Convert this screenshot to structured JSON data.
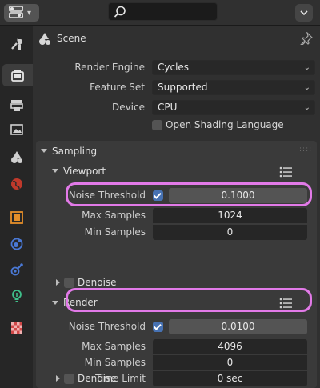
{
  "topbar": {
    "editor_type_icon": "properties-editor-icon",
    "search_icon": "search-icon",
    "menu_icon": "chevron-down-icon"
  },
  "tabs": [
    {
      "name": "tool",
      "icon": "tool-icon"
    },
    {
      "name": "render",
      "icon": "camera-back-icon",
      "active": true
    },
    {
      "name": "output",
      "icon": "printer-icon"
    },
    {
      "name": "view-layer",
      "icon": "image-icon"
    },
    {
      "name": "scene",
      "icon": "scene-icon"
    },
    {
      "name": "world",
      "icon": "world-icon"
    },
    {
      "name": "object",
      "icon": "object-icon"
    },
    {
      "name": "modifiers",
      "icon": "orbit-icon"
    },
    {
      "name": "physics",
      "icon": "constraint-icon"
    },
    {
      "name": "object-data",
      "icon": "lightbulb-icon"
    },
    {
      "name": "texture",
      "icon": "checker-icon"
    }
  ],
  "header": {
    "scene_label": "Scene"
  },
  "render_engine": {
    "label": "Render Engine",
    "value": "Cycles"
  },
  "feature_set": {
    "label": "Feature Set",
    "value": "Supported"
  },
  "device": {
    "label": "Device",
    "value": "CPU"
  },
  "osl": {
    "label": "Open Shading Language",
    "checked": false
  },
  "sampling": {
    "title": "Sampling",
    "viewport": {
      "title": "Viewport",
      "noise_threshold_label": "Noise Threshold",
      "noise_threshold_enabled": true,
      "noise_threshold_value": "0.1000",
      "max_samples_label": "Max Samples",
      "max_samples_value": "1024",
      "min_samples_label": "Min Samples",
      "min_samples_value": "0",
      "denoise_label": "Denoise"
    },
    "render": {
      "title": "Render",
      "noise_threshold_label": "Noise Threshold",
      "noise_threshold_enabled": true,
      "noise_threshold_value": "0.0100",
      "max_samples_label": "Max Samples",
      "max_samples_value": "4096",
      "min_samples_label": "Min Samples",
      "min_samples_value": "0",
      "time_limit_label": "Time Limit",
      "time_limit_value": "0 sec",
      "denoise_label": "Denoise"
    }
  },
  "colors": {
    "highlight": "#e27ae8",
    "accent": "#4772b3"
  }
}
